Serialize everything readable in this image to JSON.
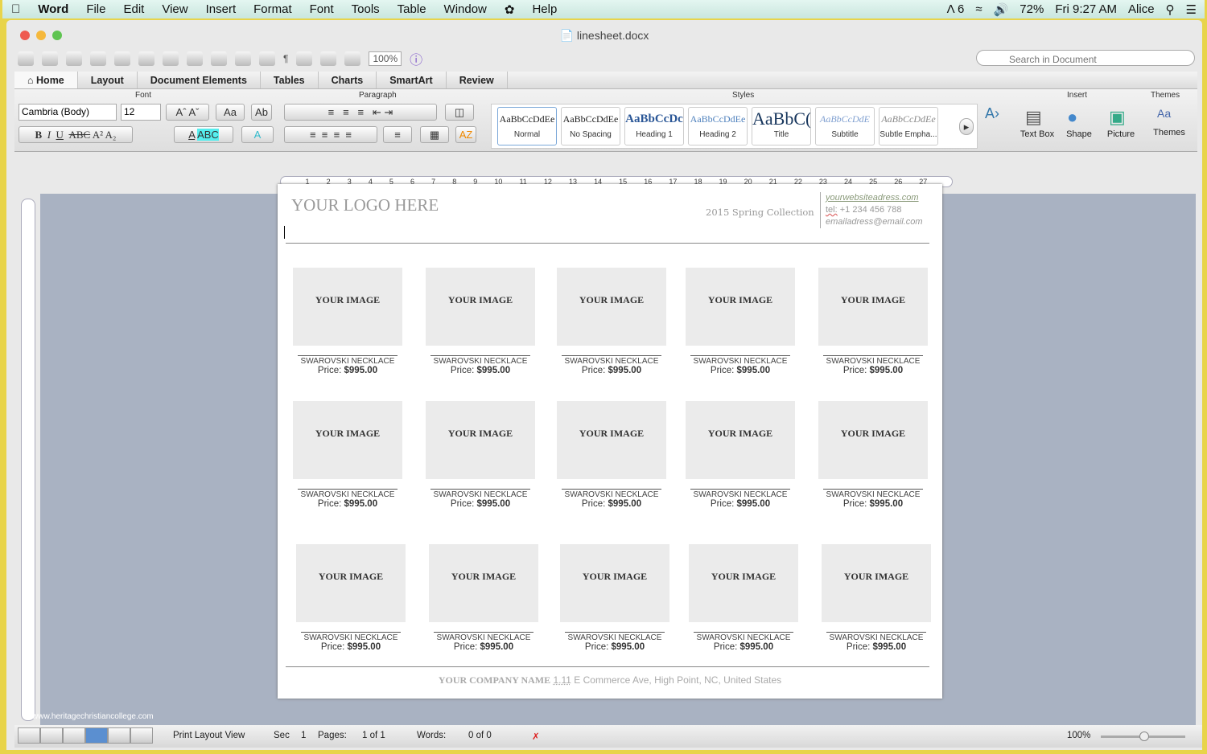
{
  "menubar": {
    "app": "Word",
    "items": [
      "File",
      "Edit",
      "View",
      "Insert",
      "Format",
      "Font",
      "Tools",
      "Table",
      "Window",
      "Help"
    ],
    "adobe_count": "6",
    "battery": "72%",
    "clock": "Fri 9:27 AM",
    "user": "Alice"
  },
  "window": {
    "title": "linesheet.docx"
  },
  "toolbar": {
    "zoom": "100%",
    "search_placeholder": "Search in Document"
  },
  "tabs": [
    "Home",
    "Layout",
    "Document Elements",
    "Tables",
    "Charts",
    "SmartArt",
    "Review"
  ],
  "ribbon": {
    "groups": {
      "font": "Font",
      "paragraph": "Paragraph",
      "styles": "Styles",
      "insert": "Insert",
      "themes": "Themes"
    },
    "font_name": "Cambria (Body)",
    "font_size": "12",
    "styles": [
      {
        "preview": "AaBbCcDdEe",
        "name": "Normal"
      },
      {
        "preview": "AaBbCcDdEe",
        "name": "No Spacing"
      },
      {
        "preview": "AaBbCcDc",
        "name": "Heading 1"
      },
      {
        "preview": "AaBbCcDdEe",
        "name": "Heading 2"
      },
      {
        "preview": "AaBbC(",
        "name": "Title"
      },
      {
        "preview": "AaBbCcDdE",
        "name": "Subtitle"
      },
      {
        "preview": "AaBbCcDdEe",
        "name": "Subtle Empha..."
      }
    ],
    "insert": [
      "Text Box",
      "Shape",
      "Picture"
    ],
    "themes": "Themes"
  },
  "ruler": [
    "1",
    "2",
    "3",
    "4",
    "5",
    "6",
    "7",
    "8",
    "9",
    "10",
    "11",
    "12",
    "13",
    "14",
    "15",
    "16",
    "17",
    "18",
    "19",
    "20",
    "21",
    "22",
    "23",
    "24",
    "25",
    "26",
    "27"
  ],
  "document": {
    "logo": "YOUR LOGO HERE",
    "collection": "2015 Spring Collection",
    "website": "yourwebsiteadress.com",
    "tel_label": "tel:",
    "tel": "+1 234 456 788",
    "email": "emailadress@email.com",
    "product": {
      "image": "YOUR IMAGE",
      "name": "SWAROVSKI NECKLACE",
      "price_label": "Price:",
      "price": "$995.00"
    },
    "rows": 3,
    "cols": 5,
    "company": "YOUR COMPANY NAME",
    "address_num": "1.11",
    "address": "E Commerce Ave, High Point, NC, United States"
  },
  "watermark": "www.heritagechristiancollege.com",
  "status": {
    "view": "Print Layout View",
    "sec_label": "Sec",
    "sec": "1",
    "pages_label": "Pages:",
    "pages": "1 of 1",
    "words_label": "Words:",
    "words": "0 of 0",
    "zoom": "100%"
  }
}
